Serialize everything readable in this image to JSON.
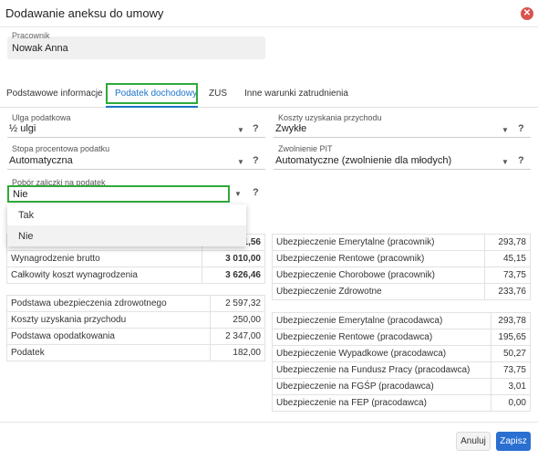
{
  "dialog": {
    "title": "Dodawanie aneksu do umowy"
  },
  "employee": {
    "label": "Pracownik",
    "name": "Nowak Anna"
  },
  "tabs": [
    "Podstawowe informacje",
    "Podatek dochodowy",
    "ZUS",
    "Inne warunki zatrudnienia"
  ],
  "fields": {
    "ulga": {
      "label": "Ulga podatkowa",
      "value": "½ ulgi"
    },
    "koszty": {
      "label": "Koszty uzyskania przychodu",
      "value": "Zwykłe"
    },
    "stopa": {
      "label": "Stopa procentowa podatku",
      "value": "Automatyczna"
    },
    "zwolnienie": {
      "label": "Zwolnienie PIT",
      "value": "Automatyczne (zwolnienie dla młodych)"
    },
    "pobor": {
      "label": "Pobór zaliczki na podatek",
      "value": "Nie"
    }
  },
  "help_glyph": "?",
  "dropdown_options": [
    "Tak",
    "Nie"
  ],
  "left_table_1": [
    [
      "",
      "1,56"
    ],
    [
      "Wynagrodzenie brutto",
      "3 010,00"
    ],
    [
      "Całkowity koszt wynagrodzenia",
      "3 626,46"
    ]
  ],
  "left_table_2": [
    [
      "Podstawa ubezpieczenia zdrowotnego",
      "2 597,32"
    ],
    [
      "Koszty uzyskania przychodu",
      "250,00"
    ],
    [
      "Podstawa opodatkowania",
      "2 347,00"
    ],
    [
      "Podatek",
      "182,00"
    ]
  ],
  "right_table_1": [
    [
      "Ubezpieczenie Emerytalne (pracownik)",
      "293,78"
    ],
    [
      "Ubezpieczenie Rentowe (pracownik)",
      "45,15"
    ],
    [
      "Ubezpieczenie Chorobowe (pracownik)",
      "73,75"
    ],
    [
      "Ubezpieczenie Zdrowotne",
      "233,76"
    ]
  ],
  "right_table_2": [
    [
      "Ubezpieczenie Emerytalne (pracodawca)",
      "293,78"
    ],
    [
      "Ubezpieczenie Rentowe (pracodawca)",
      "195,65"
    ],
    [
      "Ubezpieczenie Wypadkowe (pracodawca)",
      "50,27"
    ],
    [
      "Ubezpieczenie na Fundusz Pracy (pracodawca)",
      "73,75"
    ],
    [
      "Ubezpieczenie na FGŚP (pracodawca)",
      "3,01"
    ],
    [
      "Ubezpieczenie na FEP (pracodawca)",
      "0,00"
    ]
  ],
  "buttons": {
    "cancel": "Anuluj",
    "save": "Zapisz"
  },
  "colors": {
    "accent": "#1a73c8",
    "highlight": "#2eaa3a",
    "close": "#d9534f",
    "save": "#2b6fd1"
  }
}
